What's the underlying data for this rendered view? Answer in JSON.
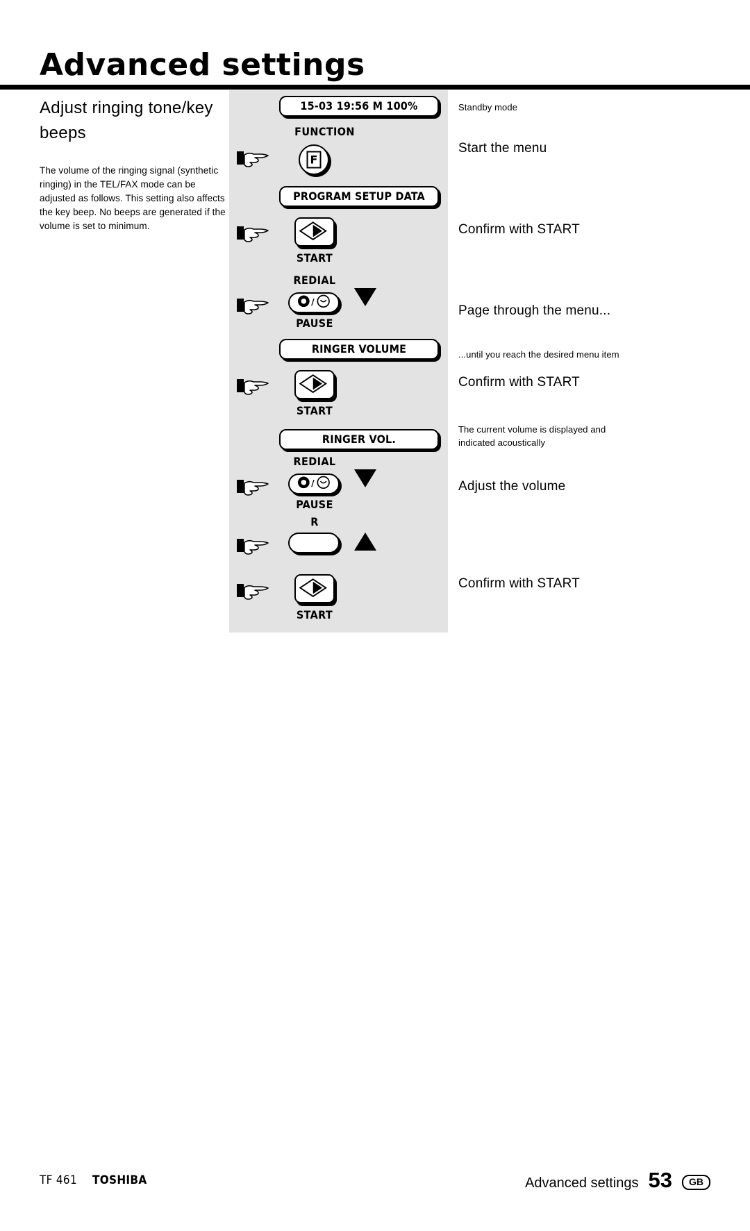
{
  "header": {
    "title": "Advanced settings"
  },
  "left_column": {
    "heading": "Adjust ringing tone/key beeps",
    "body": "The volume of the ringing signal (synthetic ringing) in the TEL/FAX mode can be adjusted as follows. This setting also affects the key beep. No beeps are generated if the volume is set to minimum."
  },
  "steps": {
    "display_standby": "15-03 19:56  M 100%",
    "function_label": "FUNCTION",
    "function_key_glyph": "F",
    "display_program": "PROGRAM SETUP DATA",
    "start_label_1": "START",
    "redial_label_1": "REDIAL",
    "pause_label_1": "PAUSE",
    "display_ringer_volume": "RINGER VOLUME",
    "start_label_2": "START",
    "display_ringer_vol": "RINGER VOL.",
    "redial_label_2": "REDIAL",
    "pause_label_2": "PAUSE",
    "r_label": "R",
    "start_label_3": "START"
  },
  "annotations": {
    "standby_mode": "Standby mode",
    "start_the_menu": "Start the menu",
    "confirm_start_1": "Confirm with START",
    "page_through": "Page through the menu...",
    "until_reach": "...until you reach the desired menu item",
    "confirm_start_2": "Confirm with START",
    "current_volume": "The current volume is displayed and indicated acoustically",
    "adjust_volume": "Adjust the volume",
    "confirm_start_3": "Confirm with START"
  },
  "footer": {
    "model": "TF 461",
    "brand": "TOSHIBA",
    "section": "Advanced settings",
    "page_number": "53",
    "locale": "GB"
  },
  "colors": {
    "panel_background": "#e3e3e3",
    "ink": "#000000",
    "page": "#ffffff"
  }
}
